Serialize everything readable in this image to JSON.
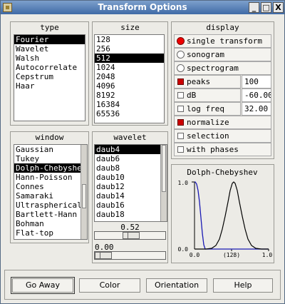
{
  "window": {
    "title": "Transform Options",
    "btn_min": "_",
    "btn_max": "□",
    "btn_close": "X"
  },
  "type_panel": {
    "title": "type",
    "items": [
      "Fourier",
      "Wavelet",
      "Walsh",
      "Autocorrelate",
      "Cepstrum",
      "Haar"
    ],
    "selected": 0
  },
  "size_panel": {
    "title": "size",
    "items": [
      "128",
      "256",
      "512",
      "1024",
      "2048",
      "4096",
      "8192",
      "16384",
      "65536"
    ],
    "selected": 2
  },
  "display_panel": {
    "title": "display",
    "single_transform": "single transform",
    "sonogram": "sonogram",
    "spectrogram": "spectrogram",
    "peaks": "peaks",
    "peaks_value": "100",
    "db": "dB",
    "db_value": "-60.00",
    "log_freq": "log freq",
    "log_freq_value": "32.00",
    "normalize": "normalize",
    "selection": "selection",
    "with_phases": "with phases"
  },
  "window_panel": {
    "title": "window",
    "items": [
      "Gaussian",
      "Tukey",
      "Dolph-Chebyshev",
      "Hann-Poisson",
      "Connes",
      "Samaraki",
      "Ultraspherical",
      "Bartlett-Hann",
      "Bohman",
      "Flat-top"
    ],
    "selected": 2
  },
  "wavelet_panel": {
    "title": "wavelet",
    "items": [
      "daub4",
      "daub6",
      "daub8",
      "daub10",
      "daub12",
      "daub14",
      "daub16",
      "daub18"
    ],
    "selected": 0
  },
  "sliders": {
    "top_value": "0.52",
    "top_fraction": 0.52,
    "bottom_value": "0.00",
    "bottom_fraction": 0.0
  },
  "graph": {
    "title": "Dolph-Chebyshev",
    "y_top": "1.0",
    "y_bottom": "0.0",
    "x_left": "0.0",
    "x_mid": "(128)",
    "x_right": "1.0"
  },
  "buttons": {
    "go_away": "Go Away",
    "color": "Color",
    "orientation": "Orientation",
    "help": "Help"
  }
}
